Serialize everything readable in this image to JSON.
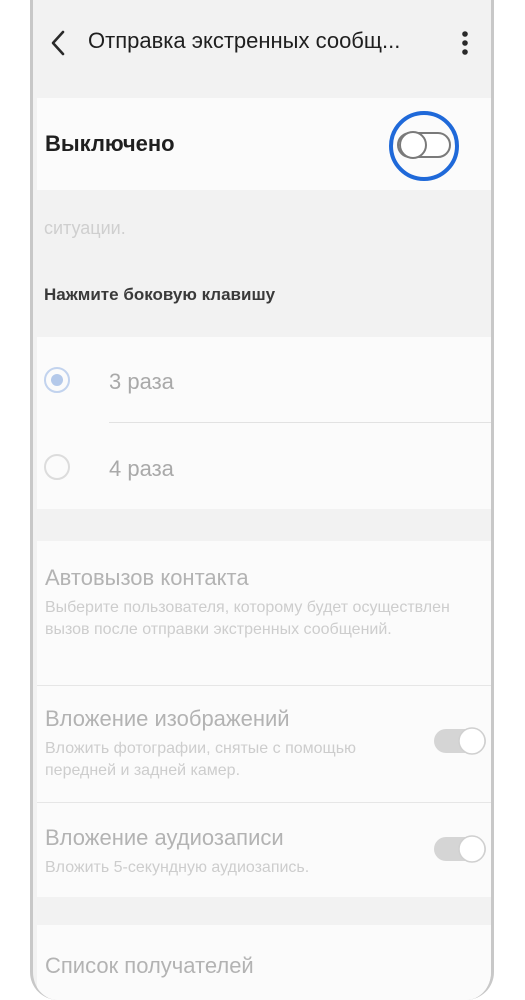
{
  "header": {
    "back_icon": "chevron-left-icon",
    "title": "Отправка экстренных сообщ...",
    "more_icon": "more-vertical-icon"
  },
  "master_switch": {
    "label": "Выключено",
    "state": "off",
    "highlighted": true,
    "highlight_color": "#1f69d9"
  },
  "description_fragment": "ситуации.",
  "press_side_key": {
    "label": "Нажмите боковую клавишу",
    "options": [
      {
        "label": "3 раза",
        "selected": true
      },
      {
        "label": "4 раза",
        "selected": false
      }
    ]
  },
  "settings": {
    "auto_call": {
      "title": "Автовызов контакта",
      "subtitle": "Выберите пользователя, которому будет осуществлен вызов после отправки экстренных сообщений."
    },
    "attach_images": {
      "title": "Вложение изображений",
      "subtitle": "Вложить фотографии, снятые с помощью передней и задней камер.",
      "toggle": "on-disabled"
    },
    "attach_audio": {
      "title": "Вложение аудиозаписи",
      "subtitle": "Вложить 5-секундную аудиозапись.",
      "toggle": "on-disabled"
    },
    "recipients": {
      "title": "Список получателей"
    }
  }
}
